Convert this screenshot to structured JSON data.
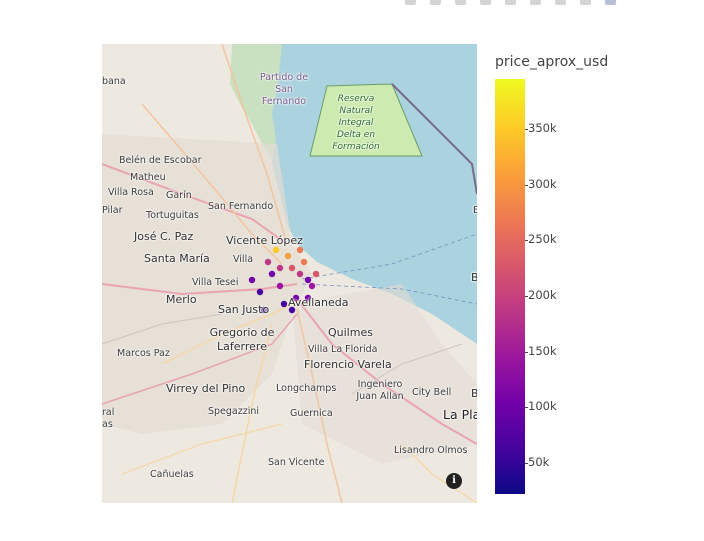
{
  "modebar": {
    "buttons": [
      "camera-icon",
      "pan-icon",
      "box-select-icon",
      "lasso-icon",
      "zoom-in-icon",
      "zoom-out-icon",
      "autoscale-icon",
      "home-icon",
      "plotly-logo-icon"
    ]
  },
  "chart_data": {
    "type": "scatter_mapbox",
    "map_style": "open-street-map",
    "color_variable": "price_aprox_usd",
    "colorscale": "Plasma",
    "colorbar": {
      "title": "price_aprox_usd",
      "ticks": [
        "50k",
        "100k",
        "150k",
        "200k",
        "250k",
        "300k",
        "350k"
      ],
      "tick_values": [
        50000,
        100000,
        150000,
        200000,
        250000,
        300000,
        350000
      ],
      "range": [
        22000,
        395000
      ]
    },
    "points_summary": "dense cluster of properties in Capital Federal (Buenos Aires)",
    "points": [
      {
        "lon": -58.4,
        "lat": -34.6,
        "price": 180000
      },
      {
        "lon": -58.42,
        "lat": -34.59,
        "price": 220000
      },
      {
        "lon": -58.38,
        "lat": -34.61,
        "price": 95000
      },
      {
        "lon": -58.45,
        "lat": -34.62,
        "price": 130000
      },
      {
        "lon": -58.43,
        "lat": -34.57,
        "price": 310000
      },
      {
        "lon": -58.39,
        "lat": -34.58,
        "price": 260000
      },
      {
        "lon": -58.47,
        "lat": -34.6,
        "price": 85000
      },
      {
        "lon": -58.5,
        "lat": -34.63,
        "price": 70000
      },
      {
        "lon": -58.41,
        "lat": -34.64,
        "price": 120000
      },
      {
        "lon": -58.37,
        "lat": -34.62,
        "price": 150000
      },
      {
        "lon": -58.46,
        "lat": -34.56,
        "price": 340000
      },
      {
        "lon": -58.48,
        "lat": -34.58,
        "price": 200000
      },
      {
        "lon": -58.44,
        "lat": -34.65,
        "price": 60000
      },
      {
        "lon": -58.52,
        "lat": -34.61,
        "price": 110000
      },
      {
        "lon": -58.36,
        "lat": -34.6,
        "price": 240000
      },
      {
        "lon": -58.42,
        "lat": -34.66,
        "price": 45000
      },
      {
        "lon": -58.49,
        "lat": -34.66,
        "price": 75000
      },
      {
        "lon": -58.4,
        "lat": -34.56,
        "price": 290000
      },
      {
        "lon": -58.38,
        "lat": -34.64,
        "price": 100000
      },
      {
        "lon": -58.45,
        "lat": -34.59,
        "price": 170000
      }
    ]
  },
  "map": {
    "labels": [
      {
        "text": "Partido de San Fernando",
        "cls": "purple",
        "name": "label-san-fernando-partido"
      },
      {
        "text": "Reserva Natural Integral Delta en Formación",
        "cls": "park",
        "name": "label-reserva"
      },
      {
        "text": "Belén de Escobar",
        "cls": "small",
        "name": "label-belen-escobar"
      },
      {
        "text": "Matheu",
        "cls": "small",
        "name": "label-matheu"
      },
      {
        "text": "Villa Rosa",
        "cls": "small",
        "name": "label-villa-rosa"
      },
      {
        "text": "Garín",
        "cls": "small",
        "name": "label-garin"
      },
      {
        "text": "Pilar",
        "cls": "small",
        "name": "label-pilar"
      },
      {
        "text": "Tortuguitas",
        "cls": "small",
        "name": "label-tortuguitas"
      },
      {
        "text": "San Fernando",
        "cls": "small",
        "name": "label-san-fernando"
      },
      {
        "text": "José C. Paz",
        "cls": "mid",
        "name": "label-jose-c-paz"
      },
      {
        "text": "Vicente López",
        "cls": "mid",
        "name": "label-vicente-lopez"
      },
      {
        "text": "Santa María",
        "cls": "mid",
        "name": "label-santa-maria"
      },
      {
        "text": "Villa",
        "cls": "small",
        "name": "label-villa"
      },
      {
        "text": "Villa Tesei",
        "cls": "small",
        "name": "label-villa-tesei"
      },
      {
        "text": "Merlo",
        "cls": "mid",
        "name": "label-merlo"
      },
      {
        "text": "Avellaneda",
        "cls": "mid",
        "name": "label-avellaneda"
      },
      {
        "text": "San Justo",
        "cls": "mid",
        "name": "label-san-justo"
      },
      {
        "text": "Quilmes",
        "cls": "mid",
        "name": "label-quilmes"
      },
      {
        "text": "Gregorio de Laferrere",
        "cls": "mid",
        "name": "label-laferrere"
      },
      {
        "text": "Villa La Florida",
        "cls": "small",
        "name": "label-villa-la-florida"
      },
      {
        "text": "Marcos Paz",
        "cls": "small",
        "name": "label-marcos-paz"
      },
      {
        "text": "Florencio Varela",
        "cls": "mid",
        "name": "label-florencio-varela"
      },
      {
        "text": "Virrey del Pino",
        "cls": "mid",
        "name": "label-virrey-del-pino"
      },
      {
        "text": "Longchamps",
        "cls": "small",
        "name": "label-longchamps"
      },
      {
        "text": "Ingeniero Juan Allan",
        "cls": "small",
        "name": "label-juan-allan"
      },
      {
        "text": "City Bell",
        "cls": "small",
        "name": "label-city-bell"
      },
      {
        "text": "Spegazzini",
        "cls": "small",
        "name": "label-spegazzini"
      },
      {
        "text": "Guernica",
        "cls": "small",
        "name": "label-guernica"
      },
      {
        "text": "La Pla",
        "cls": "big",
        "name": "label-la-plata"
      },
      {
        "text": "Lisandro Olmos",
        "cls": "small",
        "name": "label-lisandro-olmos"
      },
      {
        "text": "San Vicente",
        "cls": "small",
        "name": "label-san-vicente"
      },
      {
        "text": "Cañuelas",
        "cls": "small",
        "name": "label-canuelas"
      },
      {
        "text": "bana",
        "cls": "small",
        "name": "label-edge-bana"
      },
      {
        "text": "B",
        "cls": "small",
        "name": "label-edge-b"
      },
      {
        "text": "Br",
        "cls": "mid",
        "name": "label-edge-br"
      },
      {
        "text": "B",
        "cls": "mid",
        "name": "label-edge-b2"
      },
      {
        "text": "ral",
        "cls": "small",
        "name": "label-edge-ral"
      },
      {
        "text": "as",
        "cls": "small",
        "name": "label-edge-as"
      }
    ],
    "info_glyph": "i"
  }
}
